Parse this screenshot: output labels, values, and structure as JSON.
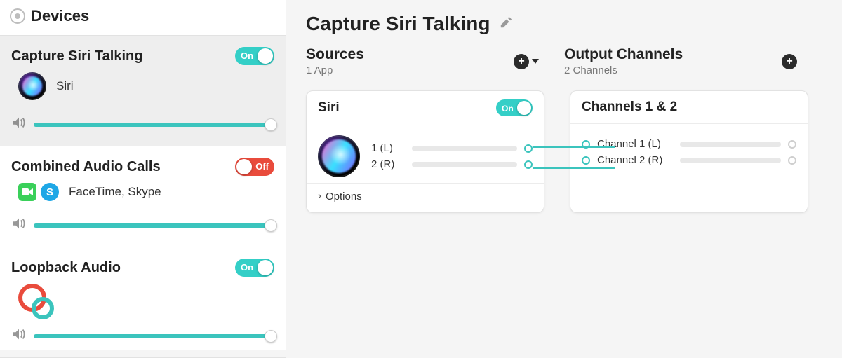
{
  "sidebar": {
    "header": "Devices",
    "devices": [
      {
        "name": "Capture Siri Talking",
        "toggle_state": "on",
        "toggle_label": "On",
        "sub_label": "Siri",
        "selected": true,
        "volume_pct": 100
      },
      {
        "name": "Combined Audio Calls",
        "toggle_state": "off",
        "toggle_label": "Off",
        "sub_label": "FaceTime, Skype",
        "selected": false,
        "volume_pct": 100
      },
      {
        "name": "Loopback Audio",
        "toggle_state": "on",
        "toggle_label": "On",
        "sub_label": "",
        "selected": false,
        "volume_pct": 100
      }
    ]
  },
  "main": {
    "page_title": "Capture Siri Talking",
    "sources": {
      "title": "Sources",
      "subtitle": "1 App"
    },
    "outputs": {
      "title": "Output Channels",
      "subtitle": "2 Channels"
    },
    "source_card": {
      "title": "Siri",
      "toggle_state": "on",
      "toggle_label": "On",
      "channels": [
        {
          "label": "1 (L)"
        },
        {
          "label": "2 (R)"
        }
      ],
      "options_label": "Options"
    },
    "output_card": {
      "title": "Channels 1 & 2",
      "channels": [
        {
          "label": "Channel 1 (L)"
        },
        {
          "label": "Channel 2 (R)"
        }
      ]
    }
  },
  "colors": {
    "accent": "#3bc4bd",
    "danger": "#e94b3c"
  }
}
